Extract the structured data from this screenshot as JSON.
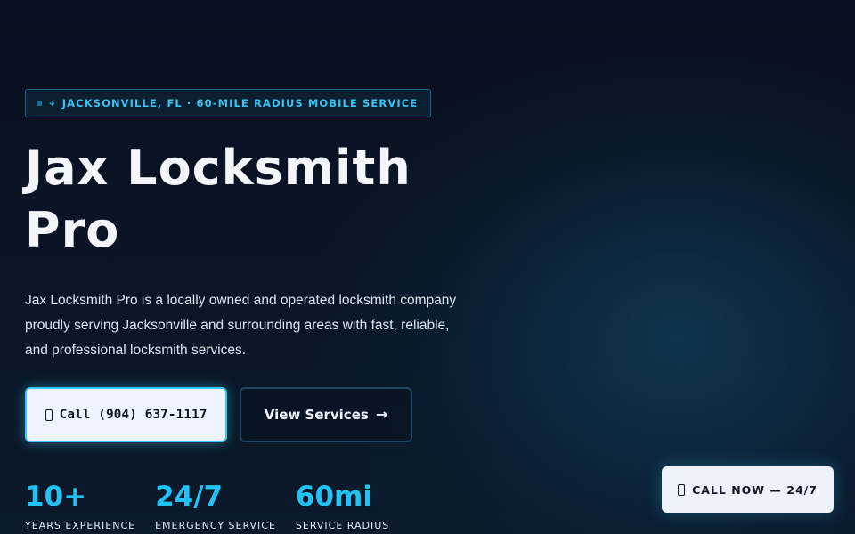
{
  "badge": {
    "text": "JACKSONVILLE, FL · 60-MILE RADIUS MOBILE SERVICE"
  },
  "hero": {
    "title_line1": "Jax Locksmith",
    "title_line2": "Pro",
    "description": "Jax Locksmith Pro is a locally owned and operated locksmith company proudly serving Jacksonville and surrounding areas with fast, reliable, and professional locksmith services."
  },
  "cta": {
    "call_label": "Call (904) 637-1117",
    "services_label": "View Services",
    "services_arrow": "→"
  },
  "stats": [
    {
      "value": "10+",
      "label": "YEARS EXPERIENCE"
    },
    {
      "value": "24/7",
      "label": "EMERGENCY SERVICE"
    },
    {
      "value": "60mi",
      "label": "SERVICE RADIUS"
    }
  ],
  "floating": {
    "call_label": "CALL NOW — 24/7"
  },
  "colors": {
    "accent": "#23c2f6",
    "background": "#0a1120",
    "button_light": "#eef4ff"
  },
  "icons": {
    "badge_icon": "map-pin-icon",
    "call_icon": "phone-icon"
  }
}
